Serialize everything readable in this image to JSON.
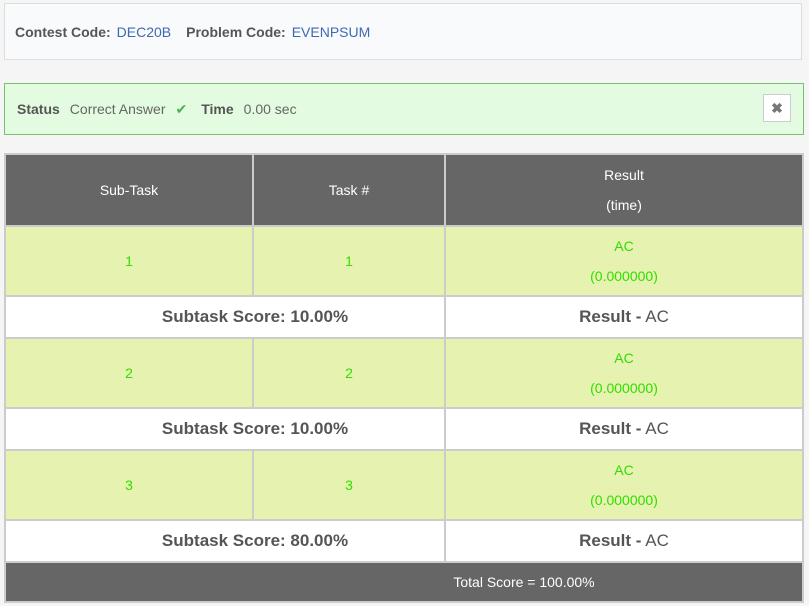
{
  "header": {
    "contest_label": "Contest Code:",
    "contest_code": "DEC20B",
    "problem_label": "Problem Code:",
    "problem_code": "EVENPSUM"
  },
  "status": {
    "status_label": "Status",
    "status_value": "Correct Answer",
    "time_label": "Time",
    "time_value": "0.00 sec",
    "check_icon": "✔",
    "close_icon": "✖"
  },
  "table": {
    "headers": {
      "subtask": "Sub-Task",
      "task": "Task #",
      "result": "Result",
      "result_sub": "(time)"
    },
    "rows": [
      {
        "subtask": "1",
        "task": "1",
        "result": "AC",
        "time": "(0.000000)",
        "score": "Subtask Score: 10.00%",
        "result_label": "Result -",
        "result_value": "AC"
      },
      {
        "subtask": "2",
        "task": "2",
        "result": "AC",
        "time": "(0.000000)",
        "score": "Subtask Score: 10.00%",
        "result_label": "Result -",
        "result_value": "AC"
      },
      {
        "subtask": "3",
        "task": "3",
        "result": "AC",
        "time": "(0.000000)",
        "score": "Subtask Score: 80.00%",
        "result_label": "Result -",
        "result_value": "AC"
      }
    ],
    "total": "Total Score = 100.00%"
  }
}
